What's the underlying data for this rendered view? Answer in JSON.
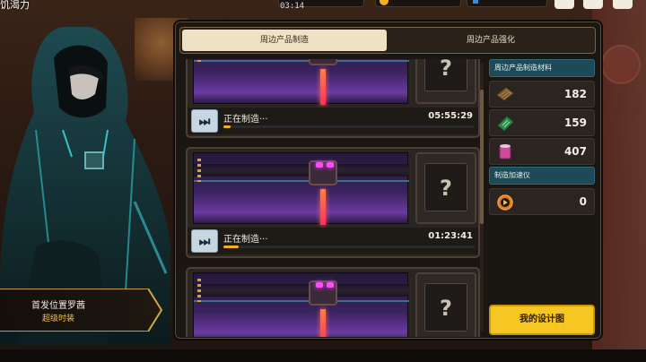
{
  "topbar": {
    "title": "饥渴力",
    "time": "03:14"
  },
  "tabs": [
    {
      "label": "周边产品制造",
      "active": true
    },
    {
      "label": "周边产品强化",
      "active": false
    }
  ],
  "production": [
    {
      "status": "正在制造···",
      "timer": "05:55:29",
      "progress": 0.03
    },
    {
      "status": "正在制造···",
      "timer": "01:23:41",
      "progress": 0.06
    },
    {
      "status": "",
      "timer": "",
      "progress": 0
    }
  ],
  "materials_header": "周边产品制造材料",
  "materials": [
    {
      "icon": "wood-plank-icon",
      "count": "182"
    },
    {
      "icon": "circuit-board-icon",
      "count": "159"
    },
    {
      "icon": "paint-bucket-icon",
      "count": "407"
    }
  ],
  "accelerator_header": "制造加速仪",
  "accelerator": {
    "icon": "speedup-clock-icon",
    "count": "0"
  },
  "design_button": "我的设计图",
  "banner": {
    "title": "首发位置罗茜",
    "subtitle": "超级时装"
  },
  "colors": {
    "accent_yellow": "#f6c622",
    "teal_header": "#1d4a56",
    "progress": "#f2b020"
  }
}
